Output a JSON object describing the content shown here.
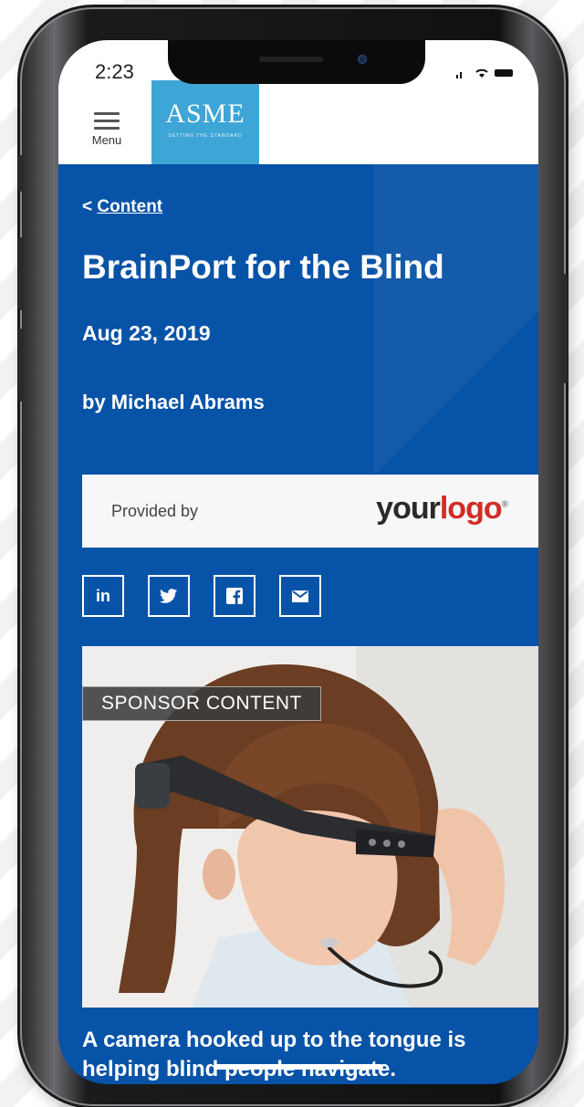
{
  "status_bar": {
    "time": "2:23"
  },
  "header": {
    "menu_label": "Menu",
    "logo_text": "ASME",
    "logo_tagline": "SETTING THE STANDARD"
  },
  "article": {
    "back_label": "< ",
    "back_link": "Content",
    "title": "BrainPort for the Blind",
    "date": "Aug 23, 2019",
    "author": "by Michael Abrams",
    "provided_by": "Provided by",
    "sponsor_logo_a": "your",
    "sponsor_logo_b": "logo",
    "sponsor_logo_mark": "®",
    "share_buttons": [
      {
        "label": "in",
        "icon": "linkedin-icon"
      },
      {
        "label": "🐦",
        "icon": "twitter-icon"
      },
      {
        "label": "f",
        "icon": "facebook-icon"
      },
      {
        "label": "✉",
        "icon": "email-icon"
      }
    ],
    "image_badge": "SPONSOR CONTENT",
    "caption": "A camera hooked up to the tongue is helping blind people navigate."
  },
  "colors": {
    "brand_blue": "#0753a7",
    "logo_blue": "#3ea5d7",
    "logo_red": "#d12d27"
  }
}
